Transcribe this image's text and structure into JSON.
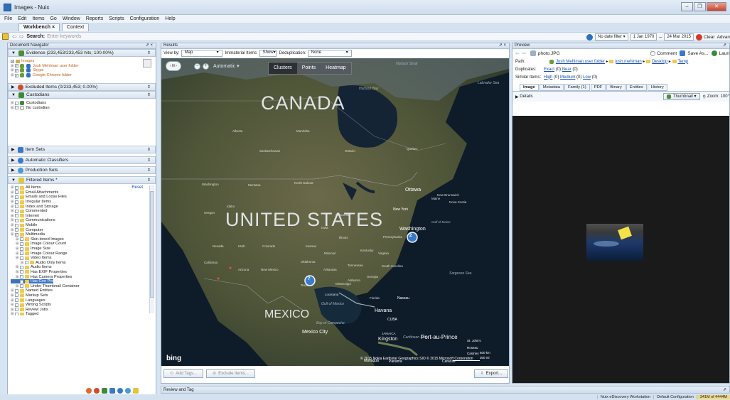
{
  "window": {
    "title": "Images - Nuix",
    "min": "–",
    "max": "❐",
    "close": "✕"
  },
  "menu": [
    "File",
    "Edit",
    "Items",
    "Go",
    "Window",
    "Reports",
    "Scripts",
    "Configuration",
    "Help"
  ],
  "tabs": [
    {
      "label": "Workbench",
      "close": "×",
      "active": true
    },
    {
      "label": "Context",
      "active": false
    }
  ],
  "search": {
    "label": "Search:",
    "placeholder": "Enter keywords",
    "date_filter": "No date filter",
    "date_from": "1 Jan 1970",
    "date_to": "24 Mar 2015",
    "clear": "Clear",
    "advanced": "Advan"
  },
  "navigator": {
    "title": "Document Navigator",
    "evidence": {
      "header": "Evidence (233,453/233,453 hits; 100.00%)",
      "items": [
        "Images",
        "Josh Mehlman user folder",
        "Skype",
        "Google Chrome folder"
      ]
    },
    "excluded": {
      "header": "Excluded Items (0/233,453; 0.00%)"
    },
    "custodians": {
      "header": "Custodians",
      "items": [
        "Custodians",
        "No custodian"
      ]
    },
    "item_sets": "Item Sets",
    "classifiers": "Automatic Classifiers",
    "production_sets": "Production Sets",
    "filtered": {
      "header": "Filtered Items *",
      "reset": "Reset",
      "items": [
        {
          "label": "All Items",
          "indent": 0
        },
        {
          "label": "Email Attachments",
          "indent": 0
        },
        {
          "label": "Emails and Loose Files",
          "indent": 0
        },
        {
          "label": "Irregular Items",
          "indent": 0
        },
        {
          "label": "Index and Storage",
          "indent": 0
        },
        {
          "label": "Commented",
          "indent": 0
        },
        {
          "label": "Internet",
          "indent": 0
        },
        {
          "label": "Communications",
          "indent": 0
        },
        {
          "label": "Mobile",
          "indent": 0
        },
        {
          "label": "Computer",
          "indent": 0
        },
        {
          "label": "Multimedia",
          "indent": 0,
          "checked": true
        },
        {
          "label": "Skin-toned Images",
          "indent": 1
        },
        {
          "label": "Image Colour Count",
          "indent": 1
        },
        {
          "label": "Image Size",
          "indent": 1
        },
        {
          "label": "Image Colour Range",
          "indent": 1
        },
        {
          "label": "Video Items",
          "indent": 1
        },
        {
          "label": "Audio Only Items",
          "indent": 2
        },
        {
          "label": "Audio Items",
          "indent": 1
        },
        {
          "label": "Has EXIF Properties",
          "indent": 1
        },
        {
          "label": "Has Camera Properties",
          "indent": 1
        },
        {
          "label": "Has Geo Properties",
          "indent": 1,
          "selected": true,
          "checked": true
        },
        {
          "label": "Under Thumbnail Container",
          "indent": 1
        },
        {
          "label": "Named Entities",
          "indent": 0
        },
        {
          "label": "Markup Sets",
          "indent": 0
        },
        {
          "label": "Languages",
          "indent": 0
        },
        {
          "label": "Writing Scripts",
          "indent": 0
        },
        {
          "label": "Review Jobs",
          "indent": 0
        },
        {
          "label": "Tagged",
          "indent": 0
        }
      ]
    }
  },
  "results": {
    "title": "Results",
    "view_by_label": "View by:",
    "view_by": "Map",
    "immaterial_label": "Immaterial Items:",
    "immaterial": "Show",
    "dedup_label": "Deduplication:",
    "dedup": "None",
    "map_modes": [
      "Clusters",
      "Points",
      "Heatmap"
    ],
    "automatic": "Automatic",
    "labels": {
      "canada": "CANADA",
      "us": "UNITED STATES",
      "mexico": "MEXICO",
      "hudson_strait": "Hudson Strait",
      "hudson_bay": "Hudson Bay",
      "labrador": "Labrador Sea",
      "gulf_mexico": "Gulf of Mexico",
      "sargasso": "Sargasso Sea",
      "caribbean": "Caribbean Sea",
      "ottawa": "Ottawa",
      "newyork": "New York",
      "washington": "Washington",
      "havana": "Havana",
      "kingston": "Kingston",
      "portauprince": "Port-au-Prince",
      "mexicocity": "Mexico City",
      "nassau": "Nassau",
      "cuba": "CUBA",
      "bay_campeche": "Bay of Campeche",
      "alberta": "Alberta",
      "manitoba": "Manitoba",
      "saskatchewan": "Saskatchewan",
      "ontario": "Ontario",
      "quebec": "Quebec",
      "washington_state": "Washington",
      "montana": "Montana",
      "nevada": "Nevada",
      "utah": "Utah",
      "colorado": "Colorado",
      "california": "California",
      "arizona": "Arizona",
      "new_mexico": "New Mexico",
      "texas": "Texas",
      "kansas": "Kansas",
      "oklahoma": "Oklahoma",
      "iowa": "Iowa",
      "missouri": "Missouri",
      "kentucky": "Kentucky",
      "tennessee": "Tennessee",
      "north_dakota": "North Dakota",
      "georgia": "Georgia",
      "florida": "Florida",
      "gulf_maine": "Gulf of Maine",
      "pennsylvania": "Pennsylvania",
      "arkansas": "Arkansas",
      "idaho": "Idaho",
      "oregon": "Oregon",
      "virginia": "Virginia",
      "south_carolina": "South Carolina",
      "illinois": "Illinois",
      "wisconsin": "Wisconsin",
      "maine": "Maine",
      "new_brunswick": "New Brunswick",
      "nova_scotia": "Nova Scotia",
      "alabama": "Alabama",
      "mississippi": "Mississippi",
      "louisiana": "Louisiana",
      "jamaica": "JAMAICA",
      "st_johns": "St. John's",
      "roseau": "Roseau",
      "castries": "Castries",
      "managua": "Managua",
      "caracas": "Caracas",
      "panama": "Panama",
      "scale_km": "500 km",
      "scale_mi": "300 mi"
    },
    "clusters": [
      {
        "count": "2"
      },
      {
        "count": "7"
      }
    ],
    "attribution": "© 2015 Nokia   Earthstar Geographics SIO   © 2015 Microsoft Corporation",
    "bing": "bing",
    "add_tags": "Add Tags...",
    "exclude_items": "Exclude Items...",
    "export": "Export..."
  },
  "preview": {
    "title": "Preview",
    "filename": "photo.JPG",
    "comment": "Comment",
    "save_as": "Save As...",
    "launch": "Laun",
    "path_label": "Path:",
    "path": [
      "Josh Mehlman user folder",
      "josh.mehlman",
      "Desktop",
      "Temp"
    ],
    "duplicates_label": "Duplicates:",
    "duplicates": [
      "Exact",
      "(0)",
      "Near",
      "(0)"
    ],
    "similar_label": "Similar items:",
    "similar": [
      "High",
      "(0)",
      "Medium",
      "(0)",
      "Low",
      "(0)"
    ],
    "tabs": [
      "Image",
      "Metadata",
      "Family (1)",
      "PDF",
      "Binary",
      "Entities",
      "History"
    ],
    "details": "Details",
    "thumbnail": "Thumbnail",
    "zoom": "Zoom: 100°"
  },
  "review": {
    "title": "Review and Tag"
  },
  "status": {
    "product": "Nuix eDiscovery Workstation",
    "config": "Default Configuration",
    "memory": "341M of 4444M"
  }
}
